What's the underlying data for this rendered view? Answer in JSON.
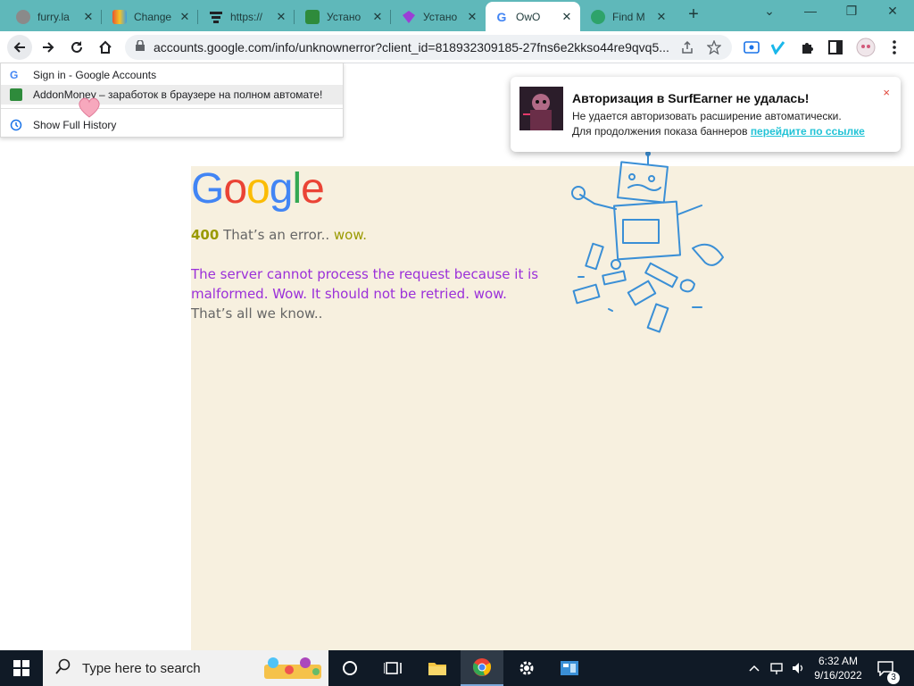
{
  "tabs": [
    {
      "title": "furry.la",
      "favicon": "globe-icon",
      "color": "#8a8a8a"
    },
    {
      "title": "Change",
      "favicon": "rainbow-icon",
      "color": "#e8552f"
    },
    {
      "title": "https://",
      "favicon": "server-icon",
      "color": "#202124"
    },
    {
      "title": "Устано",
      "favicon": "addon-icon",
      "color": "#2e8b3b"
    },
    {
      "title": "Устано",
      "favicon": "gem-icon",
      "color": "#9b3fd6"
    },
    {
      "title": "OwO",
      "favicon": "google-icon",
      "color": "#4285f4"
    },
    {
      "title": "Find M",
      "favicon": "find-icon",
      "color": "#2ea36a"
    }
  ],
  "active_tab_index": 5,
  "window_controls": {
    "minimize": "⌄",
    "min": "—",
    "restore": "❐",
    "close": "✕"
  },
  "omnibox": {
    "url": "accounts.google.com/info/unknownerror?client_id=818932309185-27fns6e2kkso44re9qvq5..."
  },
  "history_menu": {
    "items": [
      {
        "label": "Sign in - Google Accounts",
        "icon": "google-icon"
      },
      {
        "label": "AddonMoney – заработок в браузере на полном автомате!",
        "icon": "addon-icon"
      }
    ],
    "show_full_history": "Show Full History"
  },
  "notification": {
    "title": "Авторизация в SurfEarner не удалась!",
    "line1": "Не удается авторизовать расширение автоматически.",
    "line2_prefix": "Для продолжения показа баннеров ",
    "link": "перейдите по ссылке",
    "close": "×"
  },
  "page": {
    "logo_letters": [
      "G",
      "o",
      "o",
      "g",
      "l",
      "e"
    ],
    "logo_colors": [
      "#4285f4",
      "#ea4335",
      "#fbbc05",
      "#4285f4",
      "#34a853",
      "#ea4335"
    ],
    "error_code": "400",
    "error_text": " That’s an error.. ",
    "error_wow": "wow.",
    "message_purple": "The server cannot process the request because it is malformed. Wow. It should not be retried. wow.",
    "message_tail": " That’s all we know.."
  },
  "taskbar": {
    "search_placeholder": "Type here to search",
    "time": "6:32 AM",
    "date": "9/16/2022",
    "notification_count": "3"
  }
}
